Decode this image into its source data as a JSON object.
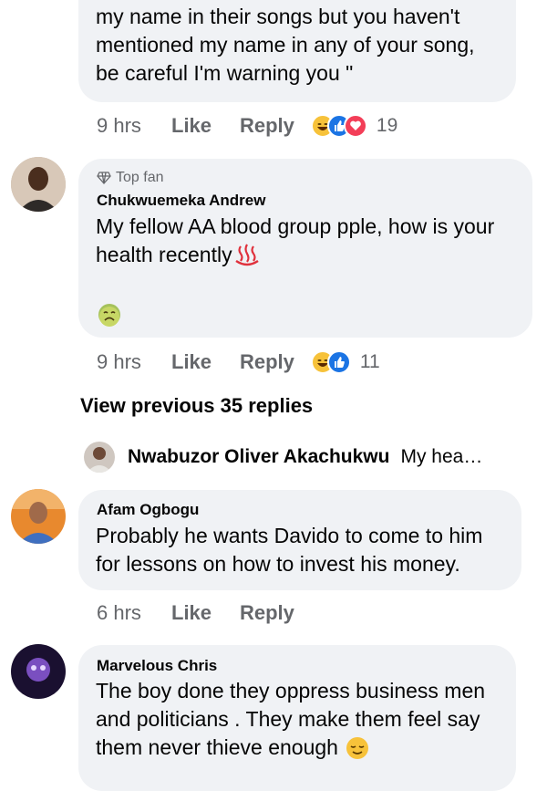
{
  "comment1": {
    "lines": [
      "my name in their songs but you haven't",
      "mentioned my name in any of your song,",
      "be careful I'm warning you \""
    ],
    "time": "9 hrs",
    "like_label": "Like",
    "reply_label": "Reply",
    "reaction_count": "19",
    "reactions": [
      "haha",
      "like",
      "love"
    ]
  },
  "comment2": {
    "badge": "Top fan",
    "author": "Chukwuemeka Andrew",
    "lines": [
      "My fellow AA blood group pple, how is your",
      "health recently"
    ],
    "emoji_inline": "hot-springs",
    "sticker": "nauseated-face",
    "time": "9 hrs",
    "like_label": "Like",
    "reply_label": "Reply",
    "reaction_count": "11",
    "reactions": [
      "haha",
      "like"
    ]
  },
  "view_previous": "View previous 35 replies",
  "latest_reply": {
    "author": "Nwabuzor Oliver Akachukwu",
    "preview": "My hea…"
  },
  "comment3": {
    "author": "Afam Ogbogu",
    "lines": [
      "Probably he wants Davido to come to him",
      "for lessons on how to invest his money."
    ],
    "time": "6 hrs",
    "like_label": "Like",
    "reply_label": "Reply"
  },
  "comment4": {
    "author": "Marvelous Chris",
    "lines": [
      "The boy done they oppress business men",
      "and politicians . They make them feel say",
      "them never thieve enough"
    ],
    "emoji_inline": "relieved-face"
  },
  "colors": {
    "bubble": "#f0f2f5",
    "meta_text": "#65676b",
    "text": "#050505"
  }
}
